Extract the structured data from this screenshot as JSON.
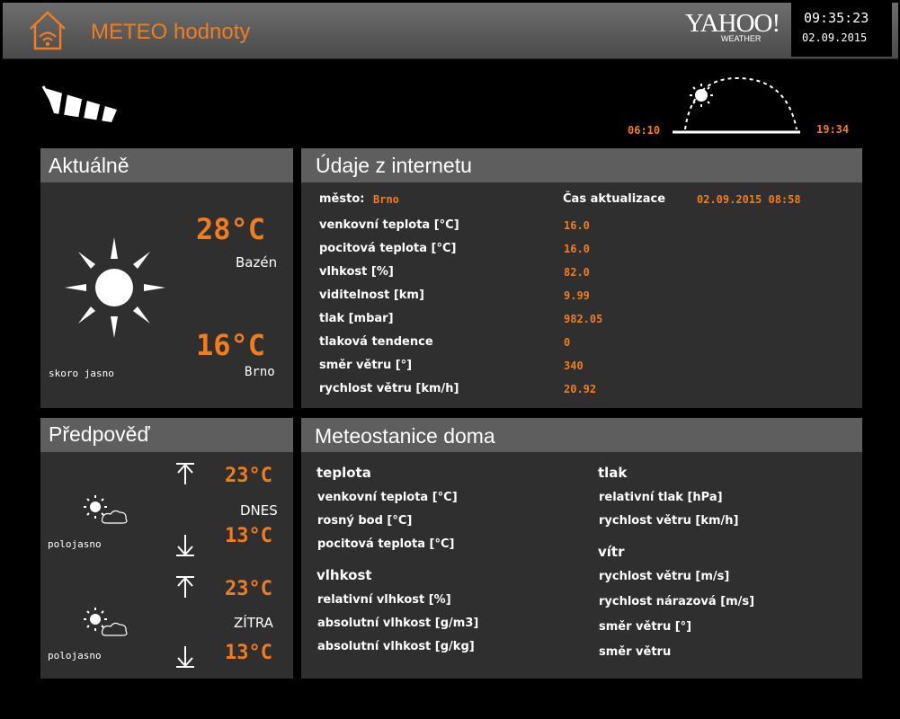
{
  "header": {
    "title": "METEO hodnoty",
    "provider_logo": "YAHOO!",
    "provider_sub": "WEATHER",
    "time": "09:35:23",
    "date": "02.09.2015",
    "icon": "home-wifi-icon"
  },
  "sun": {
    "sunrise": "06:10",
    "sunset": "19:34",
    "icon": "sun-arc-icon"
  },
  "windsock_icon": "windsock-icon",
  "current": {
    "title": "Aktuálně",
    "icon": "sun-icon",
    "pool_temp": "28°C",
    "pool_label": "Bazén",
    "city_temp": "16°C",
    "city_label": "Brno",
    "condition": "skoro jasno"
  },
  "internet": {
    "title": "Údaje z internetu",
    "city_label": "město:",
    "city_value": "Brno",
    "update_label": "Čas aktualizace",
    "update_value": "02.09.2015 08:58",
    "rows": [
      {
        "label": "venkovní teplota [°C]",
        "value": "16.0"
      },
      {
        "label": "pocitová teplota [°C]",
        "value": "16.0"
      },
      {
        "label": "vlhkost [%]",
        "value": "82.0"
      },
      {
        "label": "viditelnost [km]",
        "value": "9.99"
      },
      {
        "label": "tlak [mbar]",
        "value": "982.05"
      },
      {
        "label": "tlaková tendence",
        "value": "0"
      },
      {
        "label": "směr větru [°]",
        "value": "340"
      },
      {
        "label": "rychlost větru [km/h]",
        "value": "20.92"
      }
    ]
  },
  "forecast": {
    "title": "Předpověď",
    "days": [
      {
        "day": "DNES",
        "high": "23°C",
        "low": "13°C",
        "condition": "polojasno",
        "icon": "partly-cloudy-icon"
      },
      {
        "day": "ZÍTRA",
        "high": "23°C",
        "low": "13°C",
        "condition": "polojasno",
        "icon": "partly-cloudy-icon"
      }
    ]
  },
  "station": {
    "title": "Meteostanice doma",
    "temperature": {
      "heading": "teplota",
      "items": [
        "venkovní teplota [°C]",
        "rosný bod [°C]",
        "pocitová teplota [°C]"
      ]
    },
    "humidity": {
      "heading": "vlhkost",
      "items": [
        "relativní vlhkost [%]",
        "absolutní vlhkost [g/m3]",
        "absolutní vlhkost [g/kg]"
      ]
    },
    "pressure": {
      "heading": "tlak",
      "items": [
        "relativní tlak [hPa]",
        "rychlost větru [km/h]"
      ]
    },
    "wind": {
      "heading": "vítr",
      "items": [
        "rychlost větru [m/s]",
        "rychlost nárazová [m/s]",
        "směr větru [°]",
        "směr větru"
      ]
    }
  }
}
